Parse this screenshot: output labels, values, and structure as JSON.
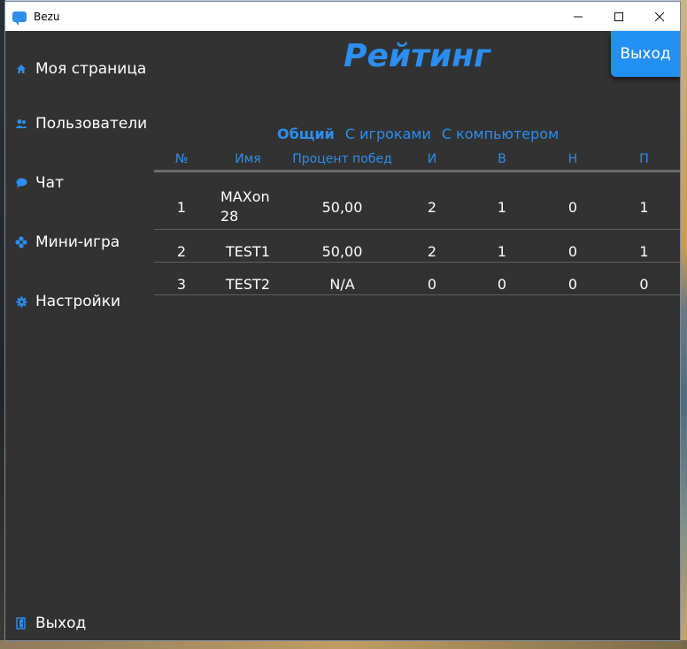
{
  "app": {
    "title": "Bezu"
  },
  "sidebar": {
    "items": [
      {
        "label": "Моя страница",
        "icon": "home-icon"
      },
      {
        "label": "Пользователи",
        "icon": "users-icon"
      },
      {
        "label": "Чат",
        "icon": "chat-icon"
      },
      {
        "label": "Мини-игра",
        "icon": "game-icon"
      },
      {
        "label": "Настройки",
        "icon": "gear-icon"
      }
    ],
    "logout": {
      "label": "Выход",
      "icon": "exit-icon"
    }
  },
  "main": {
    "title": "Рейтинг",
    "logout_button": "Выход",
    "tabs": [
      {
        "label": "Общий",
        "active": true
      },
      {
        "label": "С игроками",
        "active": false
      },
      {
        "label": "С компьютером",
        "active": false
      }
    ],
    "table": {
      "headers": [
        "№",
        "Имя",
        "Процент побед",
        "И",
        "В",
        "Н",
        "П"
      ],
      "rows": [
        {
          "num": "1",
          "name": "MAXon 28",
          "pct": "50,00",
          "i": "2",
          "v": "1",
          "n": "0",
          "p": "1"
        },
        {
          "num": "2",
          "name": "TEST1",
          "pct": "50,00",
          "i": "2",
          "v": "1",
          "n": "0",
          "p": "1"
        },
        {
          "num": "3",
          "name": "TEST2",
          "pct": "N/A",
          "i": "0",
          "v": "0",
          "n": "0",
          "p": "0"
        }
      ]
    }
  },
  "colors": {
    "accent": "#2b8ef0",
    "background": "#323232",
    "text": "#ffffff"
  }
}
